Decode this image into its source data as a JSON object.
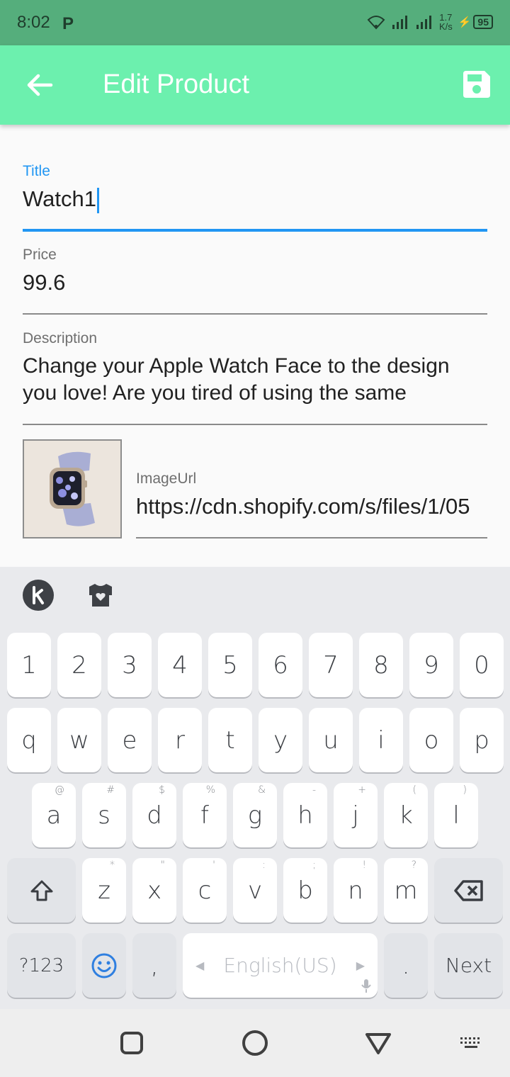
{
  "status": {
    "time": "8:02",
    "notification_letter": "P",
    "speed_value": "1.7",
    "speed_unit": "K/s",
    "battery": "95"
  },
  "app_bar": {
    "title": "Edit Product",
    "back_icon": "arrow-left-icon",
    "save_icon": "save-icon"
  },
  "form": {
    "title_label": "Title",
    "title_value": "Watch1",
    "price_label": "Price",
    "price_value": "99.6",
    "description_label": "Description",
    "description_value": "Change your Apple Watch Face to the design you love! Are you tired of using the same",
    "image_label": "ImageUrl",
    "image_value": "https://cdn.shopify.com/s/files/1/05"
  },
  "keyboard": {
    "row_numbers": [
      "1",
      "2",
      "3",
      "4",
      "5",
      "6",
      "7",
      "8",
      "9",
      "0"
    ],
    "row_q": [
      "q",
      "w",
      "e",
      "r",
      "t",
      "y",
      "u",
      "i",
      "o",
      "p"
    ],
    "row_a": [
      {
        "key": "a",
        "hint": "@"
      },
      {
        "key": "s",
        "hint": "#"
      },
      {
        "key": "d",
        "hint": "$"
      },
      {
        "key": "f",
        "hint": "%"
      },
      {
        "key": "g",
        "hint": "&"
      },
      {
        "key": "h",
        "hint": "-"
      },
      {
        "key": "j",
        "hint": "+"
      },
      {
        "key": "k",
        "hint": "("
      },
      {
        "key": "l",
        "hint": ")"
      }
    ],
    "row_z": [
      {
        "key": "z",
        "hint": "*"
      },
      {
        "key": "x",
        "hint": "\""
      },
      {
        "key": "c",
        "hint": "'"
      },
      {
        "key": "v",
        "hint": ":"
      },
      {
        "key": "b",
        "hint": ";"
      },
      {
        "key": "n",
        "hint": "!"
      },
      {
        "key": "m",
        "hint": "?"
      }
    ],
    "symbols_label": "?123",
    "comma": ",",
    "space_label": "English(US)",
    "period": ".",
    "enter_label": "Next"
  },
  "colors": {
    "status_bar": "#55ae7c",
    "app_bar": "#6cf0ae",
    "accent": "#2196f3"
  }
}
